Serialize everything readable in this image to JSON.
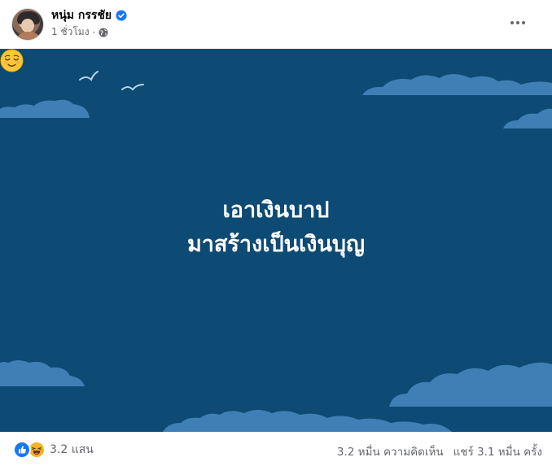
{
  "post": {
    "author": "หนุ่ม กรรชัย",
    "time": "1 ชั่วโมง",
    "separator": "·",
    "privacy_icon": "globe-icon",
    "verified_icon": "verified-badge-icon",
    "more_icon": "more-options-icon",
    "text_line1": "เอาเงินบาป",
    "text_line2": "มาสร้างเป็นเงินบุญ",
    "emoji": "relieved-face-emoji",
    "background_color": "#0d4a74"
  },
  "stats": {
    "reaction_icons": [
      "like-icon",
      "haha-icon"
    ],
    "reactions_count": "3.2 แสน",
    "comments": "3.2 หมื่น ความคิดเห็น",
    "shares": "แชร์ 3.1 หมื่น ครั้ง"
  },
  "colors": {
    "brand_blue": "#1877f2",
    "secondary_text": "#65676b",
    "cloud": "#3f7fb5"
  }
}
